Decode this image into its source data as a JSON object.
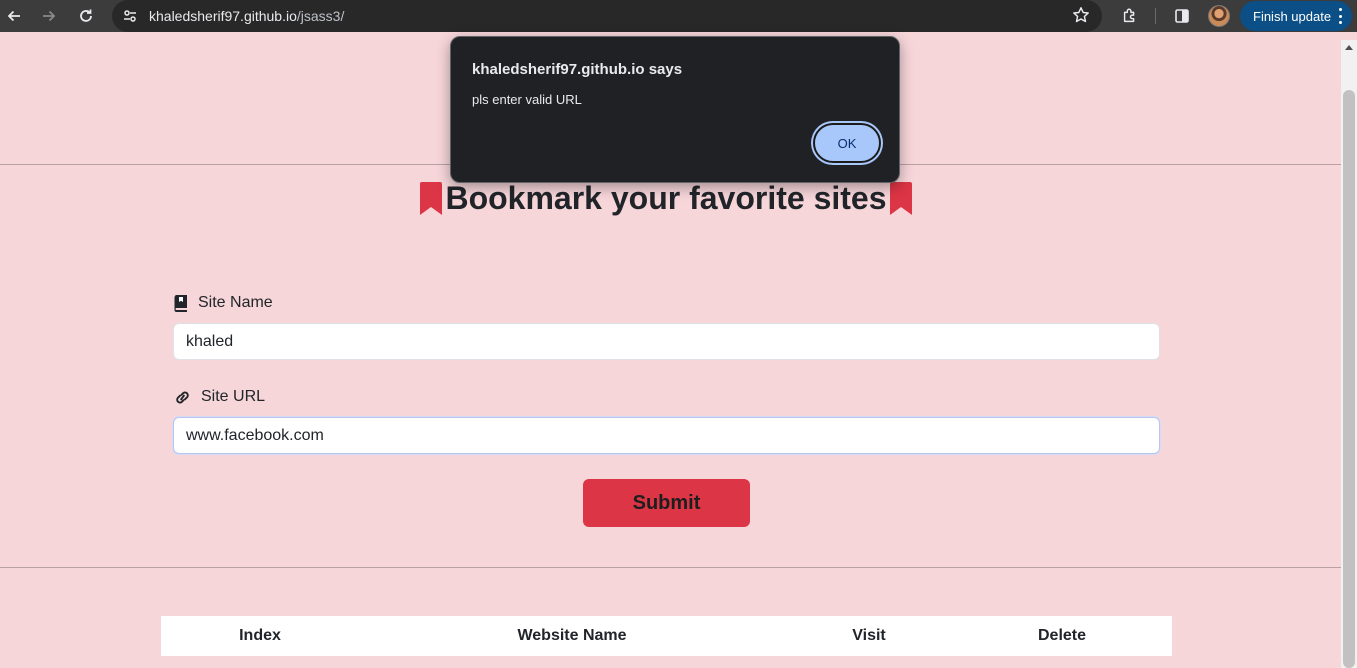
{
  "browser": {
    "url_host": "khaledsherif97.github.io",
    "url_path": "/jsass3/",
    "finish_update_label": "Finish update",
    "icons": [
      "back-icon",
      "forward-icon",
      "reload-icon",
      "site-info-icon",
      "bookmark-star-icon",
      "extensions-icon",
      "side-panel-icon",
      "profile-avatar",
      "menu-dots-icon"
    ]
  },
  "page": {
    "title": "Bookmark your favorite sites",
    "accent_color": "#dc3545",
    "background_color": "#f7d6da",
    "form": {
      "site_name_label": "Site Name",
      "site_name_value": "khaled",
      "site_url_label": "Site URL",
      "site_url_value": "www.facebook.com",
      "submit_label": "Submit"
    },
    "table": {
      "headers": [
        "Index",
        "Website Name",
        "Visit",
        "Delete"
      ]
    }
  },
  "alert": {
    "title": "khaledsherif97.github.io says",
    "message": "pls enter valid URL",
    "ok_label": "OK"
  }
}
